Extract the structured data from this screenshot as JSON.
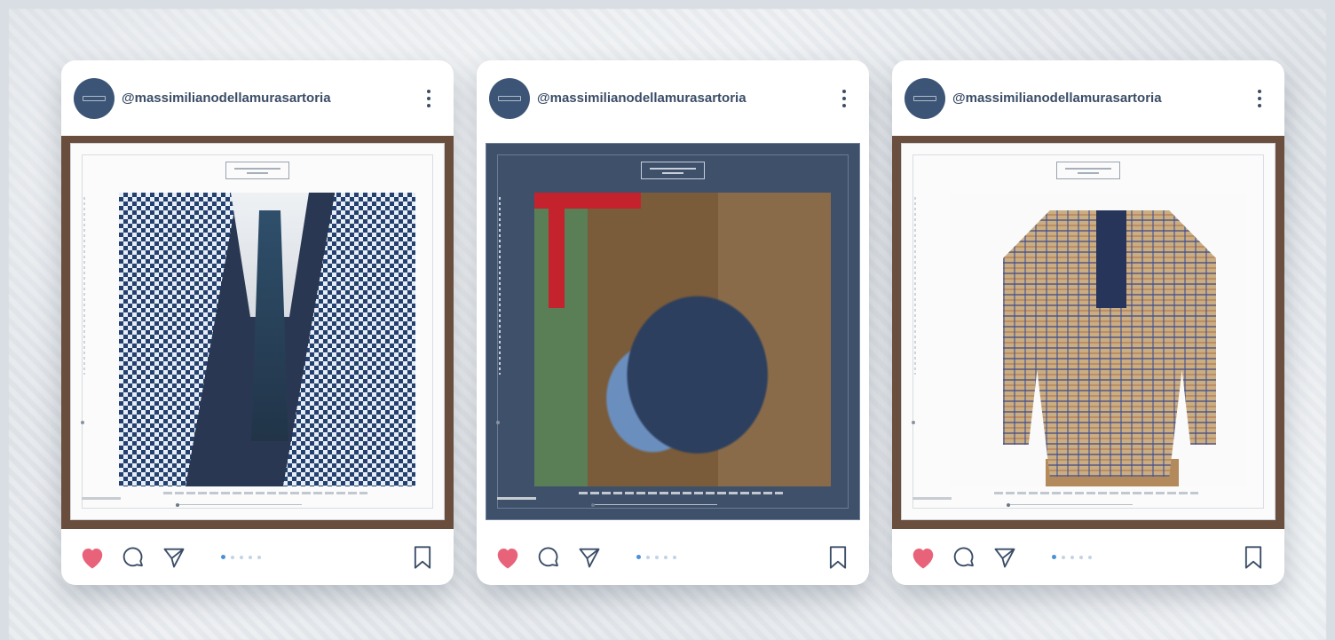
{
  "colors": {
    "accent": "#4a90d9",
    "heart": "#e8637a",
    "icon_stroke": "#3a4d66",
    "avatar_bg": "#3c5577"
  },
  "posts": [
    {
      "username": "@massimilianodellamurasartoria",
      "media": "blue-houndstooth-jacket-photo",
      "liked": true,
      "carousel": {
        "count": 5,
        "active_index": 0
      },
      "icons": {
        "more": "more-vertical-icon",
        "like": "heart-icon",
        "comment": "comment-icon",
        "share": "send-icon",
        "save": "bookmark-icon"
      }
    },
    {
      "username": "@massimilianodellamurasartoria",
      "media": "leather-bag-photo",
      "liked": true,
      "carousel": {
        "count": 5,
        "active_index": 0
      },
      "icons": {
        "more": "more-vertical-icon",
        "like": "heart-icon",
        "comment": "comment-icon",
        "share": "send-icon",
        "save": "bookmark-icon"
      }
    },
    {
      "username": "@massimilianodellamurasartoria",
      "media": "check-blazer-photo",
      "liked": true,
      "carousel": {
        "count": 5,
        "active_index": 0
      },
      "icons": {
        "more": "more-vertical-icon",
        "like": "heart-icon",
        "comment": "comment-icon",
        "share": "send-icon",
        "save": "bookmark-icon"
      }
    }
  ]
}
